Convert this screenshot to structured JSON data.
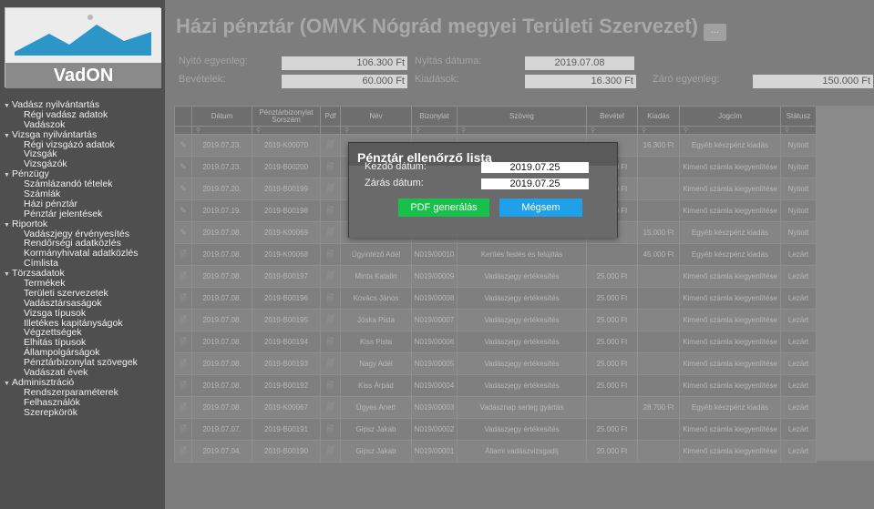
{
  "app": {
    "logo_text": "VadON"
  },
  "sidebar": {
    "groups": [
      {
        "label": "Vadász nyilvántartás",
        "items": [
          "Régi vadász adatok",
          "Vadászok"
        ]
      },
      {
        "label": "Vizsga nyilvántartás",
        "items": [
          "Régi vizsgázó adatok",
          "Vizsgák",
          "Vizsgázók"
        ]
      },
      {
        "label": "Pénzügy",
        "items": [
          "Számlázandó tételek",
          "Számlák",
          "Házi pénztár",
          "Pénztár jelentések"
        ]
      },
      {
        "label": "Riportok",
        "items": [
          "Vadászjegy érvényesítés",
          "Rendőrségi adatközlés",
          "Kormányhivatal adatközlés",
          "Címlista"
        ]
      },
      {
        "label": "Törzsadatok",
        "items": [
          "Termékek",
          "Területi szervezetek",
          "Vadásztársaságok",
          "Vizsga típusok",
          "Illetékes kapitányságok",
          "Végzettségek",
          "Elhitás típusok",
          "Állampolgárságok",
          "Pénztárbizonylat szövegek",
          "Vadászati évek"
        ]
      },
      {
        "label": "Adminisztráció",
        "items": [
          "Rendszerparaméterek",
          "Felhasználók",
          "Szerepkörök"
        ]
      }
    ]
  },
  "page": {
    "title": "Házi pénztár (OMVK Nógrád megyei Területi Szervezet)",
    "title_btn": "..."
  },
  "summary": {
    "nyito_label": "Nyitó egyenleg:",
    "nyito_value": "106.300 Ft",
    "nyitas_label": "Nyitás dátuma:",
    "nyitas_value": "2019.07.08",
    "bevetelek_label": "Bevételek:",
    "bevetelek_value": "60.000 Ft",
    "kiadasok_label": "Kiadások:",
    "kiadasok_value": "16.300 Ft",
    "zaro_label": "Záró egyenleg:",
    "zaro_value": "150.000 Ft"
  },
  "table": {
    "headers": [
      "",
      "Dátum",
      "Pénztárbizonylat Sorszám",
      "Pdf",
      "Név",
      "Bizonylat",
      "Szöveg",
      "Bevétel",
      "Kiadás",
      "Jogcím",
      "Státusz"
    ],
    "rows": [
      [
        "✎",
        "2019.07.23.",
        "2019-K00070",
        "🗎",
        "",
        "",
        "ó",
        "",
        "16.300 Ft",
        "Egyéb készpénz kiadás",
        "Nyitott"
      ],
      [
        "✎",
        "2019.07.23.",
        "2019-B00200",
        "🗎",
        "",
        "",
        "",
        "20.000 Ft",
        "",
        "Kimenő számla kiegyenlítése",
        "Nyitott"
      ],
      [
        "✎",
        "2019.07.20.",
        "2019-B00199",
        "🗎",
        "",
        "",
        "",
        "20.000 Ft",
        "",
        "Kimenő számla kiegyenlítése",
        "Nyitott"
      ],
      [
        "✎",
        "2019.07.19.",
        "2019-B00198",
        "🗎",
        "",
        "",
        "",
        "20.000 Ft",
        "",
        "Kimenő számla kiegyenlítése",
        "Nyitott"
      ],
      [
        "✎",
        "2019.07.08.",
        "2019-K00069",
        "🗎",
        "Ügyintéző Adél",
        "N019/00011",
        "Kertészeti munkák - július",
        "",
        "15.000 Ft",
        "Egyéb készpénz kiadás",
        "Nyitott"
      ],
      [
        "🗎",
        "2019.07.08.",
        "2019-K00068",
        "🗎",
        "Ügyintéző Adél",
        "N019/00010",
        "Kerítés festés és felújítás",
        "",
        "45.000 Ft",
        "Egyéb készpénz kiadás",
        "Lezárt"
      ],
      [
        "🗎",
        "2019.07.08.",
        "2019-B00197",
        "🗎",
        "Minta Katalin",
        "N019/00009",
        "Vadászjegy értékesítés",
        "25.000 Ft",
        "",
        "Kimenő számla kiegyenlítése",
        "Lezárt"
      ],
      [
        "🗎",
        "2019.07.08.",
        "2019-B00196",
        "🗎",
        "Kovács János",
        "N019/00008",
        "Vadászjegy értékesítés",
        "25.000 Ft",
        "",
        "Kimenő számla kiegyenlítése",
        "Lezárt"
      ],
      [
        "🗎",
        "2019.07.08.",
        "2019-B00195",
        "🗎",
        "Jóska Pista",
        "N019/00007",
        "Vadászjegy értékesítés",
        "25.000 Ft",
        "",
        "Kimenő számla kiegyenlítése",
        "Lezárt"
      ],
      [
        "🗎",
        "2019.07.08.",
        "2019-B00194",
        "🗎",
        "Kiss Pista",
        "N019/00006",
        "Vadászjegy értékesítés",
        "25.000 Ft",
        "",
        "Kimenő számla kiegyenlítése",
        "Lezárt"
      ],
      [
        "🗎",
        "2019.07.08.",
        "2019-B00193",
        "🗎",
        "Nagy Adél",
        "N019/00005",
        "Vadászjegy értékesítés",
        "25.000 Ft",
        "",
        "Kimenő számla kiegyenlítése",
        "Lezárt"
      ],
      [
        "🗎",
        "2019.07.08.",
        "2019-B00192",
        "🗎",
        "Kiss Árpád",
        "N019/00004",
        "Vadászjegy értékesítés",
        "25.000 Ft",
        "",
        "Kimenő számla kiegyenlítése",
        "Lezárt"
      ],
      [
        "🗎",
        "2019.07.08.",
        "2019-K00067",
        "🗎",
        "Ügyes Anett",
        "N019/00003",
        "Vadásznap serleg gyártás",
        "",
        "28.700 Ft",
        "Egyéb készpénz kiadás",
        "Lezárt"
      ],
      [
        "🗎",
        "2019.07.07.",
        "2019-B00191",
        "🗎",
        "Gipsz Jakab",
        "N019/00002",
        "Vadászjegy értékesítés",
        "25.000 Ft",
        "",
        "Kimenő számla kiegyenlítése",
        "Lezárt"
      ],
      [
        "🗎",
        "2019.07.04.",
        "2019-B00190",
        "🗎",
        "Gipsz Jakab",
        "N019/00001",
        "Állami vadászvizsgadíj",
        "20.000 Ft",
        "",
        "Kimenő számla kiegyenlítése",
        "Lezárt"
      ]
    ]
  },
  "modal": {
    "title": "Pénztár ellenőrző lista",
    "kezdo_label": "Kezdő dátum:",
    "kezdo_value": "2019.07.25",
    "zaras_label": "Zárás dátum:",
    "zaras_value": "2019.07.25",
    "pdf_btn": "PDF generálás",
    "cancel_btn": "Mégsem"
  },
  "colors": {
    "pdf_button": "#17c04a",
    "cancel_button": "#1fa0e8",
    "overlay": "#7d7d7d"
  }
}
